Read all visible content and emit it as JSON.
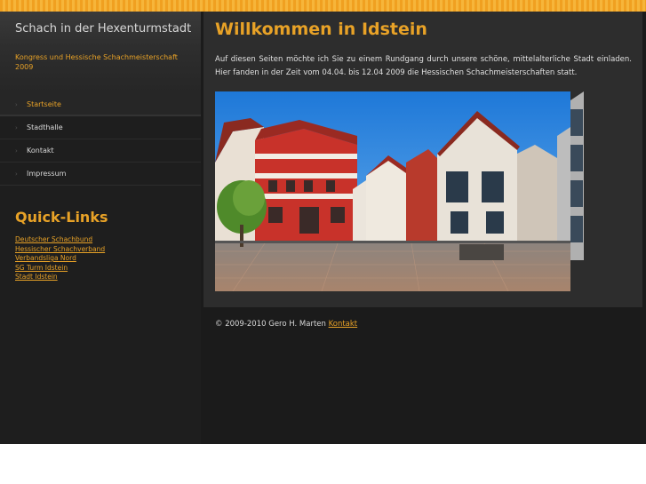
{
  "site": {
    "title": "Schach in der Hexenturmstadt",
    "subtitle": "Kongress und Hessische Schachmeisterschaft 2009"
  },
  "nav": {
    "items": [
      {
        "label": "Startseite",
        "active": true
      },
      {
        "label": "Stadthalle",
        "active": false
      },
      {
        "label": "Kontakt",
        "active": false
      },
      {
        "label": "Impressum",
        "active": false
      }
    ]
  },
  "quick_links": {
    "title": "Quick-Links",
    "links": [
      "Deutscher Schachbund",
      "Hessischer Schachverband",
      "Verbandsliga Nord",
      "SG Turm Idstein",
      "Stadt Idstein"
    ]
  },
  "main": {
    "title": "Willkommen in Idstein",
    "intro": "Auf diesen Seiten möchte ich Sie zu einem Rundgang durch unsere schöne, mittelalterliche Stadt einladen. Hier fanden in der Zeit vom 04.04. bis 12.04 2009 die Hessischen Schachmeisterschaften statt."
  },
  "footer": {
    "copyright": "© 2009-2010 Gero H. Marten",
    "contact_link": "Kontakt"
  },
  "colors": {
    "accent": "#e8a227",
    "background": "#1b1b1b",
    "panel": "#2d2d2d"
  }
}
